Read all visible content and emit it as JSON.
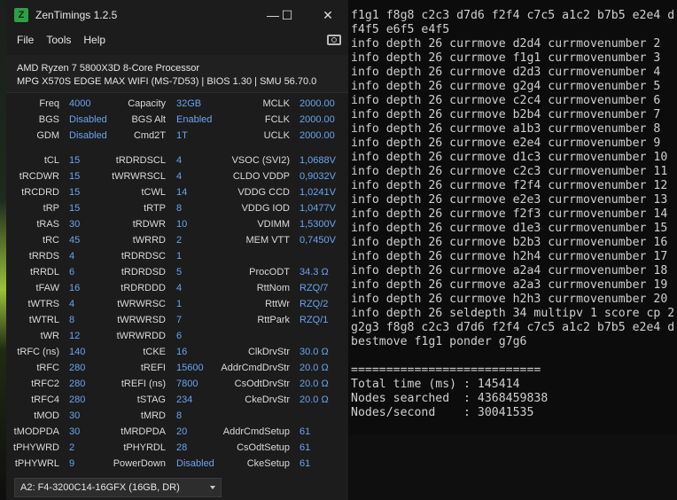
{
  "window": {
    "title": "ZenTimings 1.2.5",
    "icon_letter": "Z",
    "menu": [
      "File",
      "Tools",
      "Help"
    ],
    "buttons": {
      "minimize": "—",
      "maximize": "☐",
      "close": "✕"
    }
  },
  "system": {
    "cpu": "AMD Ryzen 7 5800X3D 8-Core Processor",
    "board": "MPG X570S EDGE MAX WIFI (MS-7D53) | BIOS 1.30 | SMU 56.70.0"
  },
  "timings": {
    "rows_top": [
      [
        [
          "Freq",
          "4000"
        ],
        [
          "Capacity",
          "32GB"
        ],
        [
          "MCLK",
          "2000.00"
        ]
      ],
      [
        [
          "BGS",
          "Disabled"
        ],
        [
          "BGS Alt",
          "Enabled"
        ],
        [
          "FCLK",
          "2000.00"
        ]
      ],
      [
        [
          "GDM",
          "Disabled"
        ],
        [
          "Cmd2T",
          "1T"
        ],
        [
          "UCLK",
          "2000.00"
        ]
      ]
    ],
    "rows_main": [
      [
        [
          "tCL",
          "15"
        ],
        [
          "tRDRDSCL",
          "4"
        ],
        [
          "VSOC (SVI2)",
          "1,0688V"
        ]
      ],
      [
        [
          "tRCDWR",
          "15"
        ],
        [
          "tWRWRSCL",
          "4"
        ],
        [
          "CLDO VDDP",
          "0,9032V"
        ]
      ],
      [
        [
          "tRCDRD",
          "15"
        ],
        [
          "tCWL",
          "14"
        ],
        [
          "VDDG CCD",
          "1,0241V"
        ]
      ],
      [
        [
          "tRP",
          "15"
        ],
        [
          "tRTP",
          "8"
        ],
        [
          "VDDG IOD",
          "1,0477V"
        ]
      ],
      [
        [
          "tRAS",
          "30"
        ],
        [
          "tRDWR",
          "10"
        ],
        [
          "VDIMM",
          "1,5300V"
        ]
      ],
      [
        [
          "tRC",
          "45"
        ],
        [
          "tWRRD",
          "2"
        ],
        [
          "MEM VTT",
          "0,7450V"
        ]
      ],
      [
        [
          "tRRDS",
          "4"
        ],
        [
          "tRDRDSC",
          "1"
        ],
        [
          "",
          ""
        ]
      ],
      [
        [
          "tRRDL",
          "6"
        ],
        [
          "tRDRDSD",
          "5"
        ],
        [
          "ProcODT",
          "34.3 Ω"
        ]
      ],
      [
        [
          "tFAW",
          "16"
        ],
        [
          "tRDRDDD",
          "4"
        ],
        [
          "RttNom",
          "RZQ/7"
        ]
      ],
      [
        [
          "tWTRS",
          "4"
        ],
        [
          "tWRWRSC",
          "1"
        ],
        [
          "RttWr",
          "RZQ/2"
        ]
      ],
      [
        [
          "tWTRL",
          "8"
        ],
        [
          "tWRWRSD",
          "7"
        ],
        [
          "RttPark",
          "RZQ/1"
        ]
      ],
      [
        [
          "tWR",
          "12"
        ],
        [
          "tWRWRDD",
          "6"
        ],
        [
          "",
          ""
        ]
      ],
      [
        [
          "tRFC (ns)",
          "140"
        ],
        [
          "tCKE",
          "16"
        ],
        [
          "ClkDrvStr",
          "30.0 Ω"
        ]
      ],
      [
        [
          "tRFC",
          "280"
        ],
        [
          "tREFI",
          "15600"
        ],
        [
          "AddrCmdDrvStr",
          "20.0 Ω"
        ]
      ],
      [
        [
          "tRFC2",
          "280"
        ],
        [
          "tREFI (ns)",
          "7800"
        ],
        [
          "CsOdtDrvStr",
          "20.0 Ω"
        ]
      ],
      [
        [
          "tRFC4",
          "280"
        ],
        [
          "tSTAG",
          "234"
        ],
        [
          "CkeDrvStr",
          "20.0 Ω"
        ]
      ],
      [
        [
          "tMOD",
          "30"
        ],
        [
          "tMRD",
          "8"
        ],
        [
          "",
          ""
        ]
      ],
      [
        [
          "tMODPDA",
          "30"
        ],
        [
          "tMRDPDA",
          "20"
        ],
        [
          "AddrCmdSetup",
          "61"
        ]
      ],
      [
        [
          "tPHYWRD",
          "2"
        ],
        [
          "tPHYRDL",
          "28"
        ],
        [
          "CsOdtSetup",
          "61"
        ]
      ],
      [
        [
          "tPHYWRL",
          "9"
        ],
        [
          "PowerDown",
          "Disabled"
        ],
        [
          "CkeSetup",
          "61"
        ]
      ]
    ]
  },
  "profile_select": {
    "selected": "A2: F4-3200C14-16GFX (16GB, DR)"
  },
  "terminal": {
    "lines": [
      "f1g1 f8g8 c2c3 d7d6 f2f4 c7c5 a1c2 b7b5 e2e4 d",
      "f4f5 e6f5 e4f5",
      "info depth 26 currmove d2d4 currmovenumber 2",
      "info depth 26 currmove f1g1 currmovenumber 3",
      "info depth 26 currmove d2d3 currmovenumber 4",
      "info depth 26 currmove g2g4 currmovenumber 5",
      "info depth 26 currmove c2c4 currmovenumber 6",
      "info depth 26 currmove b2b4 currmovenumber 7",
      "info depth 26 currmove a1b3 currmovenumber 8",
      "info depth 26 currmove e2e4 currmovenumber 9",
      "info depth 26 currmove d1c3 currmovenumber 10",
      "info depth 26 currmove c2c3 currmovenumber 11",
      "info depth 26 currmove f2f4 currmovenumber 12",
      "info depth 26 currmove e2e3 currmovenumber 13",
      "info depth 26 currmove f2f3 currmovenumber 14",
      "info depth 26 currmove d1e3 currmovenumber 15",
      "info depth 26 currmove b2b3 currmovenumber 16",
      "info depth 26 currmove h2h4 currmovenumber 17",
      "info depth 26 currmove a2a4 currmovenumber 18",
      "info depth 26 currmove a2a3 currmovenumber 19",
      "info depth 26 currmove h2h3 currmovenumber 20",
      "info depth 26 seldepth 34 multipv 1 score cp 2",
      "g2g3 f8g8 c2c3 d7d6 f2f4 c7c5 a1c2 b7b5 e2e4 d",
      "bestmove f1g1 ponder g7g6",
      "",
      "===========================",
      "Total time (ms) : 145414",
      "Nodes searched  : 4368459838",
      "Nodes/second    : 30041535"
    ]
  }
}
